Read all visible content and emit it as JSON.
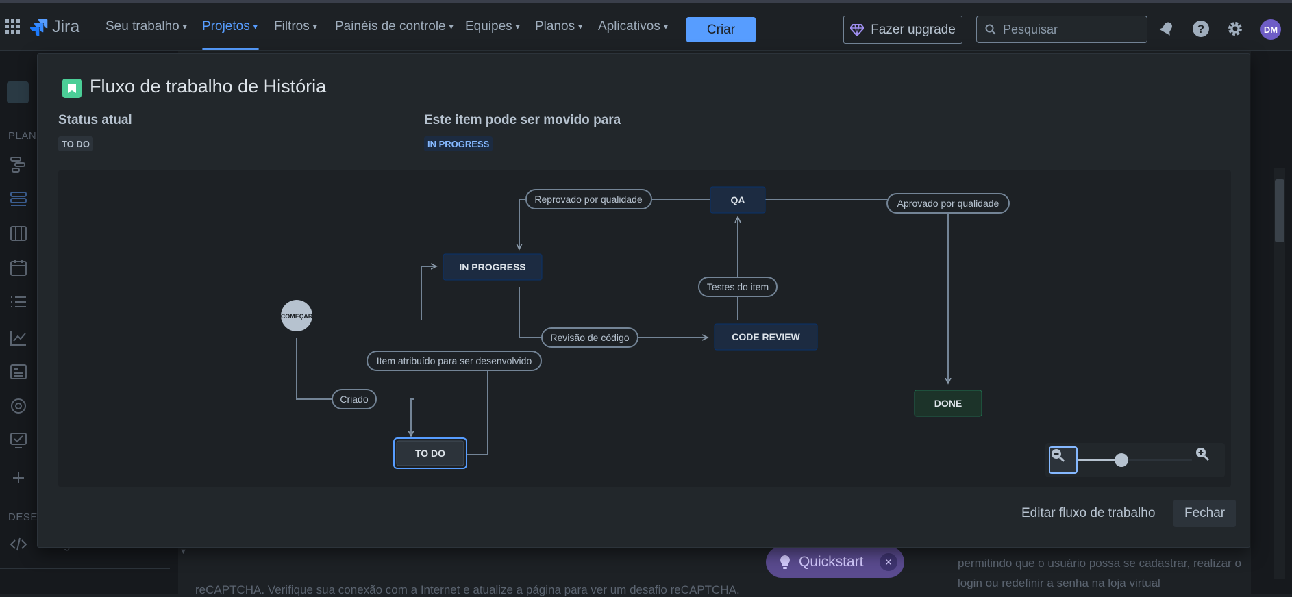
{
  "topnav": {
    "logo_text": "Jira",
    "items": [
      {
        "label": "Seu trabalho"
      },
      {
        "label": "Projetos"
      },
      {
        "label": "Filtros"
      },
      {
        "label": "Painéis de controle"
      },
      {
        "label": "Equipes"
      },
      {
        "label": "Planos"
      },
      {
        "label": "Aplicativos"
      }
    ],
    "create_label": "Criar",
    "upgrade_label": "Fazer upgrade",
    "search_placeholder": "Pesquisar",
    "avatar_initials": "DM"
  },
  "background": {
    "sidebar_label_plan": "PLANE",
    "sidebar_label_dev": "DESEN",
    "sidebar_code": "Código",
    "bottom_text": "reCAPTCHA. Verifique sua conexão com a Internet e atualize a página para ver um desafio reCAPTCHA.",
    "right_text": "permitindo que o usuário possa se cadastrar, realizar o login ou redefinir a senha na loja virtual",
    "quickstart_label": "Quickstart"
  },
  "modal": {
    "title": "Fluxo de trabalho de História",
    "current_status_label": "Status atual",
    "current_status": "TO DO",
    "can_move_label": "Este item pode ser movido para",
    "can_move_status": "IN PROGRESS",
    "edit_button": "Editar fluxo de trabalho",
    "close_button": "Fechar"
  },
  "workflow": {
    "start_label": "COMEÇAR",
    "statuses": {
      "todo": "TO DO",
      "in_progress": "IN PROGRESS",
      "qa": "QA",
      "code_review": "CODE REVIEW",
      "done": "DONE"
    },
    "transitions": {
      "criado": "Criado",
      "atribuido": "Item atribuído para ser desenvolvido",
      "reprovado": "Reprovado por qualidade",
      "revisao": "Revisão de código",
      "testes": "Testes do item",
      "aprovado": "Aprovado por qualidade"
    },
    "zoom_level": 0.38
  },
  "colors": {
    "accent": "#579dff",
    "status_blue_bg": "#1c2b41",
    "status_done_bg": "#1c3329",
    "status_todo_bg": "#2c333a"
  }
}
